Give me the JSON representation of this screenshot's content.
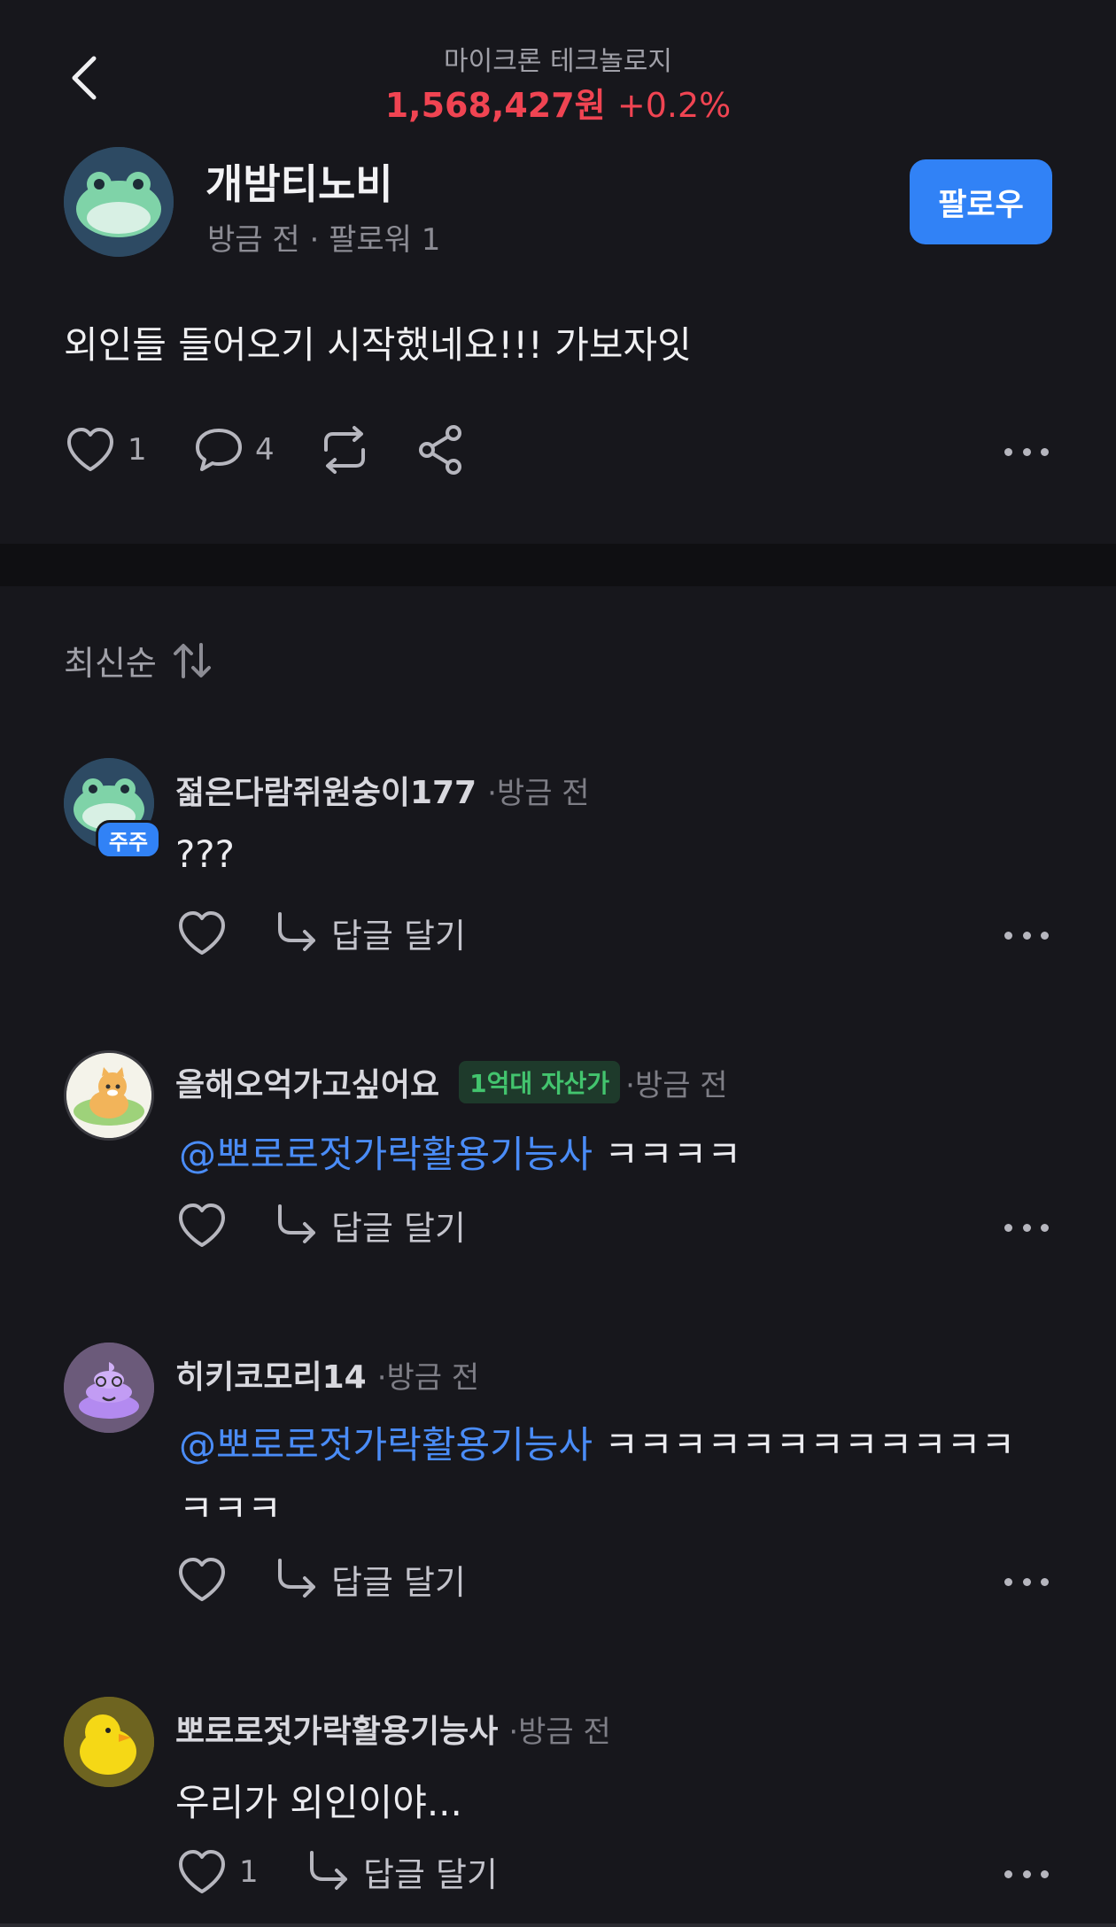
{
  "header": {
    "back_icon": "chevron-left-icon",
    "stock_name": "마이크론 테크놀로지",
    "price": "1,568,427원",
    "change": "+0.2%",
    "price_color": "#f04452"
  },
  "post": {
    "author": "개밤티노비",
    "meta": "방금 전 · 팔로워 1",
    "follow_label": "팔로우",
    "body": "외인들 들어오기 시작했네요!!! 가보자잇",
    "like_count": "1",
    "comment_count": "4"
  },
  "sort_label": "최신순",
  "comments": [
    {
      "name": "젊은다람쥐원숭이177",
      "time": "·방금 전",
      "badge": "주주",
      "text": "???",
      "reply_label": "답글 달기"
    },
    {
      "name": "올해오억가고싶어요",
      "badge": "1억대 자산가",
      "time": "·방금 전",
      "mention": "@뽀로로젓가락활용기능사",
      "text": "ㅋㅋㅋㅋ",
      "reply_label": "답글 달기"
    },
    {
      "name": "히키코모리14",
      "time": "·방금 전",
      "mention": "@뽀로로젓가락활용기능사",
      "text": "ㅋㅋㅋㅋㅋㅋㅋㅋㅋㅋㅋㅋ",
      "text2": "ㅋㅋㅋ",
      "reply_label": "답글 달기"
    },
    {
      "name": "뽀로로젓가락활용기능사",
      "time": "·방금 전",
      "text": "우리가 외인이야...",
      "like_count": "1",
      "reply_label": "답글 달기"
    }
  ],
  "colors": {
    "accent": "#3182f6",
    "background": "#17171c",
    "mention": "#4a8cf7"
  }
}
